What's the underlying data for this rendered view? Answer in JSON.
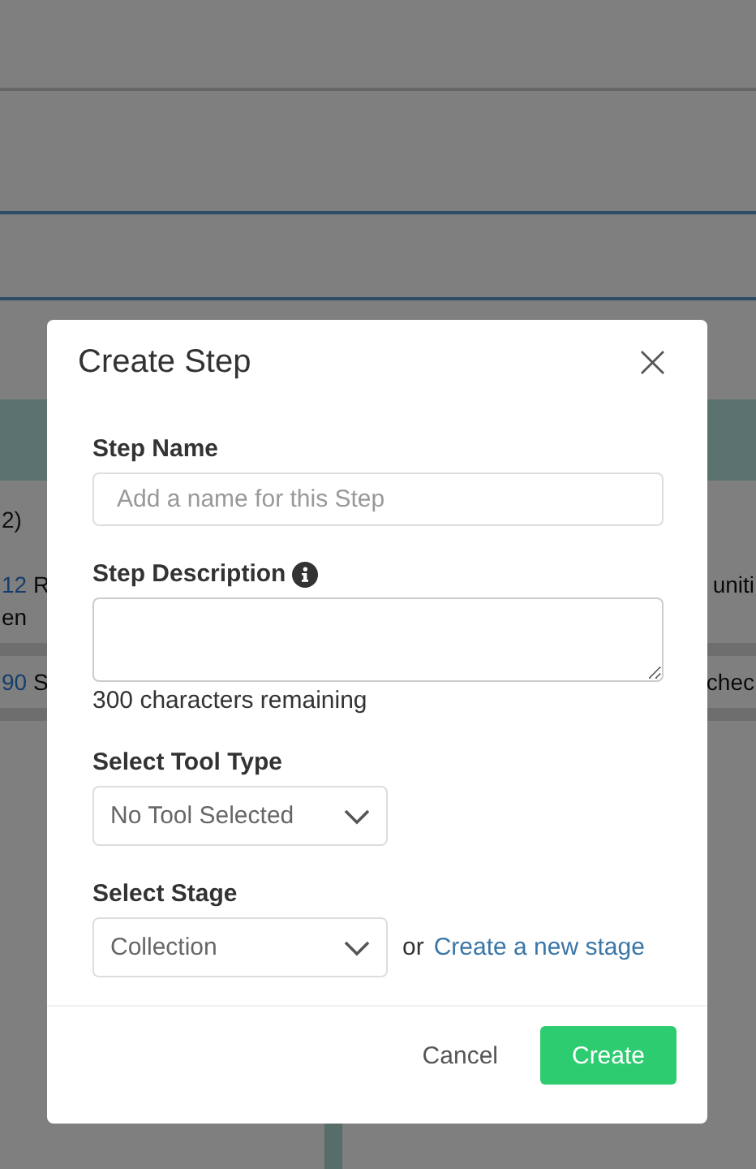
{
  "background": {
    "list_heading": "2)",
    "rows": [
      {
        "id": "12",
        "text": "R",
        "text_line_2": "en",
        "right_text": "uniti"
      },
      {
        "id": "90",
        "text": "S",
        "right_text": "chec"
      }
    ]
  },
  "dialog": {
    "title": "Create Step",
    "close": "×",
    "fields": [
      {
        "kind": "text",
        "label": "Step Name",
        "placeholder": "Add a name for this Step"
      },
      {
        "kind": "textarea",
        "label": "Step Description",
        "has_info": true,
        "counter": "300 characters remaining"
      },
      {
        "kind": "select",
        "label": "Select Tool Type",
        "value": "No Tool Selected"
      },
      {
        "kind": "select",
        "label": "Select Stage",
        "value": "Collection",
        "or_text": "or",
        "link": "Create a new stage"
      }
    ],
    "buttons": [
      {
        "kind": "secondary",
        "label": "Cancel"
      },
      {
        "kind": "primary",
        "label": "Create"
      }
    ]
  }
}
